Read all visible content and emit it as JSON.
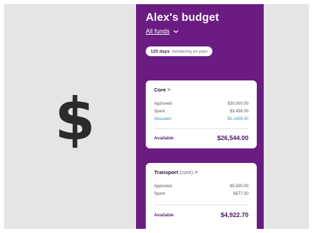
{
  "icon": {
    "name": "dollar-sign-icon",
    "glyph": "$"
  },
  "budget": {
    "title": "Alex's budget",
    "funds_label": "All funds",
    "days_value": "120 days",
    "days_suffix": "remaining on plan"
  },
  "cards": [
    {
      "name": "Core",
      "sub": "",
      "arrow": ">",
      "approved_label": "Approved",
      "approved_value": "$30,000.00",
      "spent_label": "Spent",
      "spent_value": "$3,456.00",
      "allocated_label": "Allocated",
      "allocated_value": "$1,1456.00",
      "available_label": "Available",
      "available_value": "$26,544.00"
    },
    {
      "name": "Transport",
      "sub": "(core)",
      "arrow": ">",
      "approved_label": "Approved",
      "approved_value": "$5,500.00",
      "spent_label": "Spent",
      "spent_value": "$577.30",
      "available_label": "Available",
      "available_value": "$4,922.70"
    }
  ],
  "colors": {
    "brand_purple": "#6a1c82",
    "allocated_blue": "#4a8ab5",
    "available_purple": "#4a1465"
  }
}
